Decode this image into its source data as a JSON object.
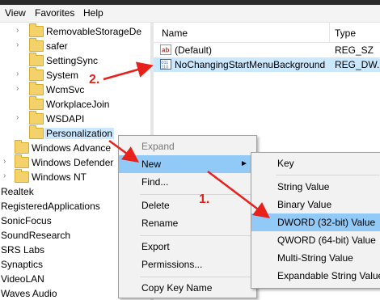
{
  "menubar": {
    "items": [
      "View",
      "Favorites",
      "Help"
    ]
  },
  "tree": {
    "folders": [
      {
        "label": "RemovableStorageDe",
        "chevron": "›"
      },
      {
        "label": "safer",
        "chevron": "›"
      },
      {
        "label": "SettingSync",
        "chevron": ""
      },
      {
        "label": "System",
        "chevron": "›"
      },
      {
        "label": "WcmSvc",
        "chevron": "›"
      },
      {
        "label": "WorkplaceJoin",
        "chevron": ""
      },
      {
        "label": "WSDAPI",
        "chevron": "›"
      },
      {
        "label": "Personalization",
        "chevron": ""
      },
      {
        "label": "Windows Advance",
        "chevron": ""
      },
      {
        "label": "Windows Defender",
        "chevron": "›"
      },
      {
        "label": "Windows NT",
        "chevron": "›"
      }
    ],
    "plain": [
      "Realtek",
      "RegisteredApplications",
      "SonicFocus",
      "SoundResearch",
      "SRS Labs",
      "Synaptics",
      "VideoLAN",
      "Waves Audio"
    ]
  },
  "values_pane": {
    "header_name": "Name",
    "header_type": "Type",
    "rows": [
      {
        "name": "(Default)",
        "type": "REG_SZ",
        "icon": "string-value-icon"
      },
      {
        "name": "NoChangingStartMenuBackground",
        "type": "REG_DW...",
        "icon": "binary-value-icon"
      }
    ]
  },
  "context_menu": {
    "items": [
      "Expand",
      "New",
      "Find...",
      "Delete",
      "Rename",
      "Export",
      "Permissions...",
      "Copy Key Name"
    ]
  },
  "submenu": {
    "items": [
      "Key",
      "String Value",
      "Binary Value",
      "DWORD (32-bit) Value",
      "QWORD (64-bit) Value",
      "Multi-String Value",
      "Expandable String Value"
    ]
  },
  "annotations": {
    "step1": "1.",
    "step2": "2."
  },
  "colors": {
    "highlight": "#91c9f7",
    "selection": "#cce8ff",
    "annotation_red": "#e8211b"
  }
}
